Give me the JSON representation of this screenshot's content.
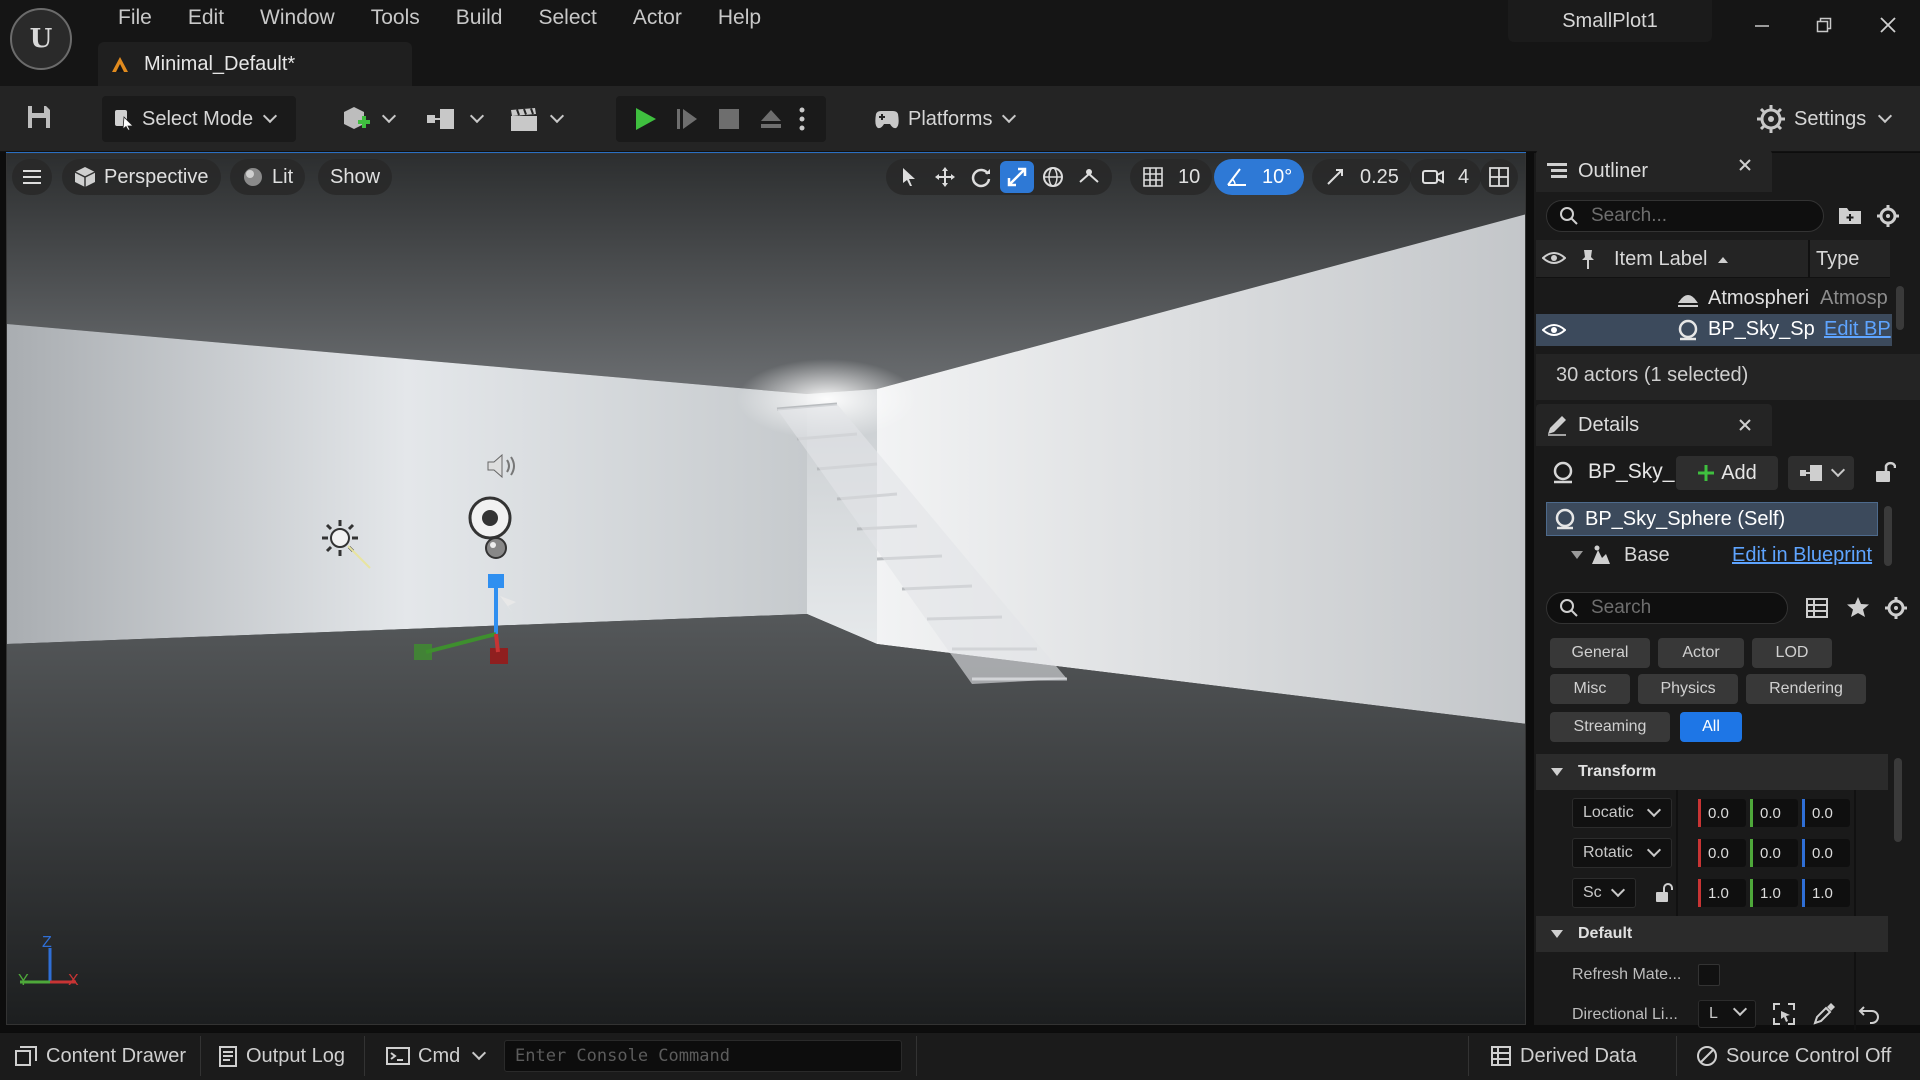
{
  "app": {
    "logo": "unreal-engine-logo",
    "project_name": "SmallPlot1",
    "document_tab": "Minimal_Default*"
  },
  "menu": [
    "File",
    "Edit",
    "Window",
    "Tools",
    "Build",
    "Select",
    "Actor",
    "Help"
  ],
  "toolbar": {
    "select_mode": "Select Mode",
    "platforms": "Platforms",
    "settings": "Settings"
  },
  "viewport": {
    "view_mode": "Perspective",
    "lighting": "Lit",
    "show": "Show",
    "grid_snap": "10",
    "rotation_snap": "10°",
    "scale_snap": "0.25",
    "camera_speed": "4",
    "axis_labels": {
      "y": "Y",
      "z": "Z",
      "x": "X"
    }
  },
  "outliner": {
    "title": "Outliner",
    "search_placeholder": "Search...",
    "col_label": "Item Label",
    "col_type": "Type",
    "rows": [
      {
        "label": "Atmospheri",
        "type": "Atmosp",
        "selected": false
      },
      {
        "label": "BP_Sky_Sp",
        "type": "Edit BP",
        "selected": true
      }
    ],
    "status": "30 actors (1 selected)"
  },
  "details": {
    "title": "Details",
    "actor_name": "BP_Sky_",
    "add_label": "Add",
    "component_self": "BP_Sky_Sphere (Self)",
    "component_base": "Base",
    "edit_in_blueprint": "Edit in Blueprint",
    "search_placeholder": "Search",
    "filters": [
      "General",
      "Actor",
      "LOD",
      "Misc",
      "Physics",
      "Rendering",
      "Streaming",
      "All"
    ],
    "active_filter": "All",
    "transform_header": "Transform",
    "location_label": "Locatic",
    "rotation_label": "Rotatic",
    "scale_label": "Sc",
    "location": [
      "0.0",
      "0.0",
      "0.0"
    ],
    "rotation": [
      "0.0",
      "0.0",
      "0.0"
    ],
    "scale": [
      "1.0",
      "1.0",
      "1.0"
    ],
    "default_header": "Default",
    "refresh_material_label": "Refresh Mate...",
    "directional_light_label": "Directional Li...",
    "directional_light_value": "L"
  },
  "bottom": {
    "content_drawer": "Content Drawer",
    "output_log": "Output Log",
    "cmd": "Cmd",
    "console_placeholder": "Enter Console Command",
    "derived_data": "Derived Data",
    "source_control": "Source Control Off"
  },
  "colors": {
    "accent_blue": "#1e76e6",
    "play_green": "#3fbf3f",
    "x_red": "#c83434",
    "y_green": "#4ea83a",
    "z_blue": "#2f6fd6"
  }
}
